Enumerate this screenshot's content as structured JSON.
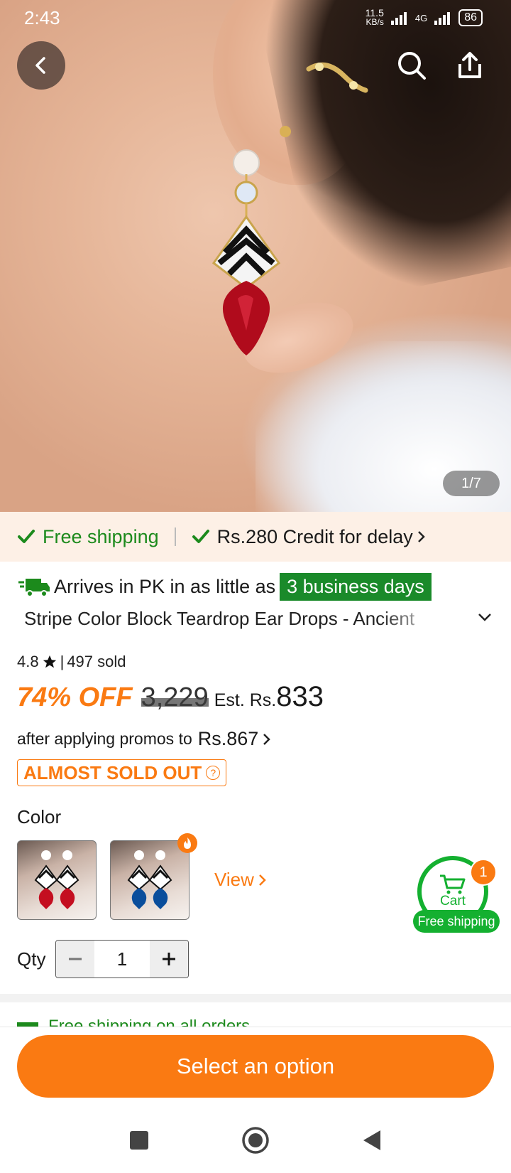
{
  "status_bar": {
    "time": "2:43",
    "net_speed": "11.5",
    "net_unit": "KB/s",
    "network": "4G",
    "battery": "86"
  },
  "gallery": {
    "pager": "1/7"
  },
  "shipping": {
    "free": "Free shipping",
    "credit": "Rs.280 Credit for delay"
  },
  "arrival": {
    "prefix": "Arrives in PK in as little as",
    "badge": "3 business days"
  },
  "product": {
    "title": "Stripe Color Block Teardrop Ear Drops - Ancient",
    "rating": "4.8",
    "sold": "497 sold",
    "discount": "74% OFF",
    "original_price": "3,229",
    "est_label": "Est. Rs.",
    "est_price": "833",
    "promo_prefix": "after applying promos to",
    "promo_price": "Rs.867",
    "stock_badge": "ALMOST SOLD OUT"
  },
  "color": {
    "label": "Color",
    "view_link": "View",
    "options": [
      "red",
      "blue"
    ]
  },
  "cart": {
    "label": "Cart",
    "count": "1",
    "badge": "Free shipping"
  },
  "qty": {
    "label": "Qty",
    "value": "1"
  },
  "peek": {
    "text": "Free shipping on all orders"
  },
  "cta": {
    "label": "Select an option"
  },
  "colors": {
    "accent": "#fa7a12",
    "green": "#14b030",
    "ship_green": "#1c8a1c"
  }
}
